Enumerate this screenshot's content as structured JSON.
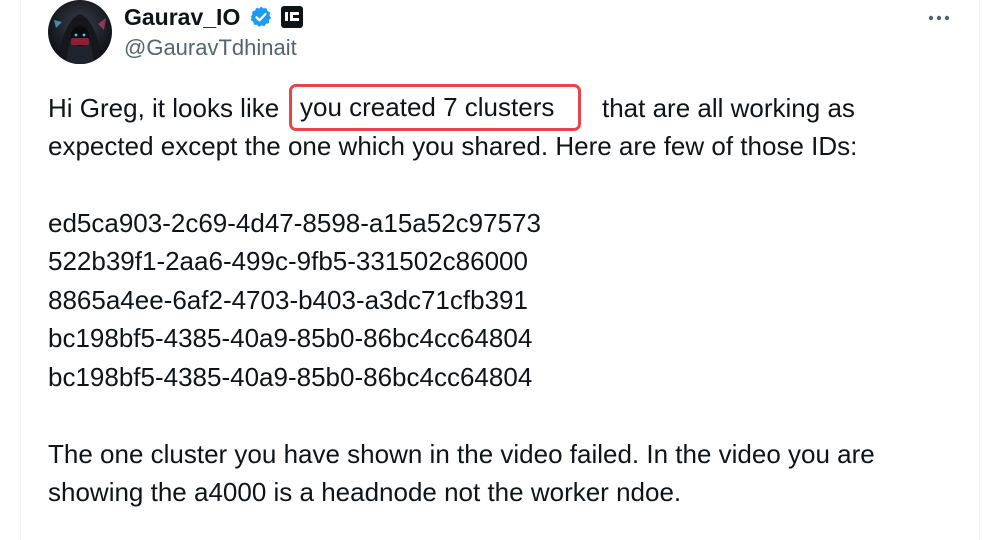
{
  "author": {
    "display_name": "Gaurav_IO",
    "handle": "@GauravTdhinait",
    "avatar": "avatar-hooded-figure-icon",
    "verified_icon": "verified-badge-icon",
    "affiliate_icon": "affiliate-badge-icon"
  },
  "more_icon": "more-horizontal-icon",
  "tweet": {
    "line1_start": "Hi Greg, it looks like",
    "highlight": "you created 7 clusters",
    "line1_end": "that are all working as",
    "line2": "expected except the one which you shared. Here are few of those IDs:",
    "ids": [
      "ed5ca903-2c69-4d47-8598-a15a52c97573",
      "522b39f1-2aa6-499c-9fb5-331502c86000",
      "8865a4ee-6af2-4703-b403-a3dc71cfb391",
      "bc198bf5-4385-40a9-85b0-86bc4cc64804",
      "bc198bf5-4385-40a9-85b0-86bc4cc64804"
    ],
    "closing_line1": "The one cluster you have shown in the video failed. In the video you are",
    "closing_line2": "showing the a4000 is a headnode not the worker ndoe."
  },
  "colors": {
    "text": "#0f1419",
    "secondary_text": "#536471",
    "verified_blue": "#1d9bf0",
    "highlight_border": "#e8454a",
    "divider": "#eff3f4"
  }
}
